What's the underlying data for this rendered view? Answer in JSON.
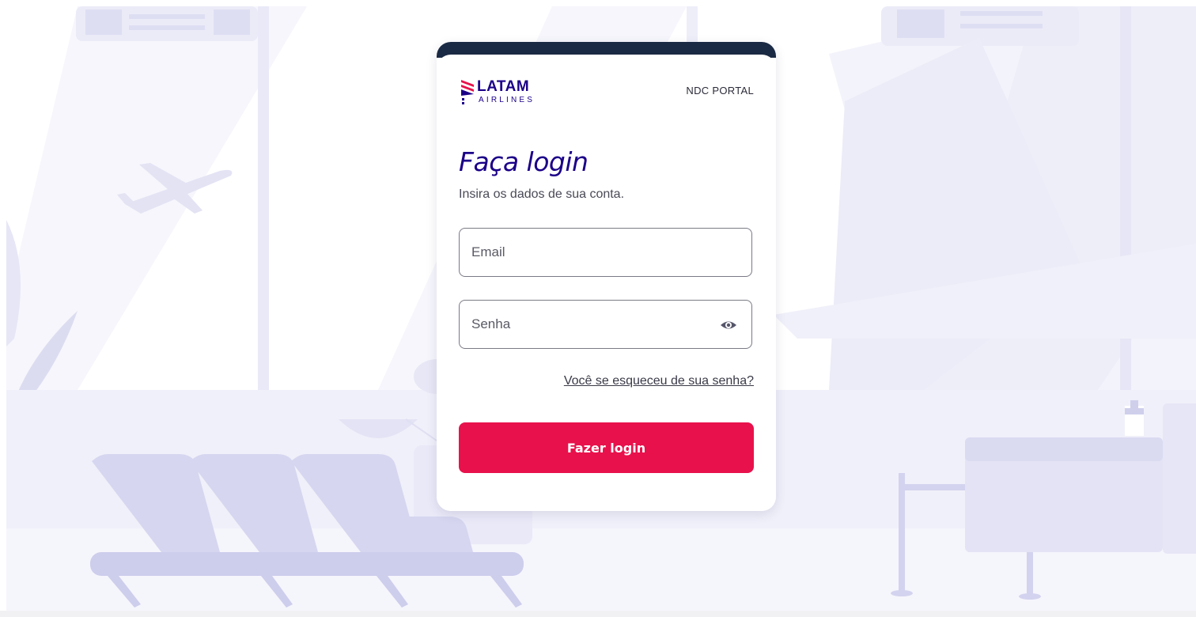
{
  "brand": {
    "name": "LATAM",
    "sub": "AIRLINES",
    "color": "#1b0088",
    "accent": "#e8114b",
    "topbar": "#1b2a44"
  },
  "header": {
    "portal": "NDC PORTAL"
  },
  "login": {
    "title": "Faça login",
    "subtitle": "Insira os dados de sua conta.",
    "email_placeholder": "Email",
    "password_placeholder": "Senha",
    "show_password_icon": "eye-icon",
    "forgot_link": "Você se esqueceu de sua senha?",
    "submit_label": "Fazer login"
  },
  "background": {
    "palette": [
      "#f4f4fc",
      "#e9e9f8",
      "#dcdcf2",
      "#cfd0ee"
    ]
  }
}
